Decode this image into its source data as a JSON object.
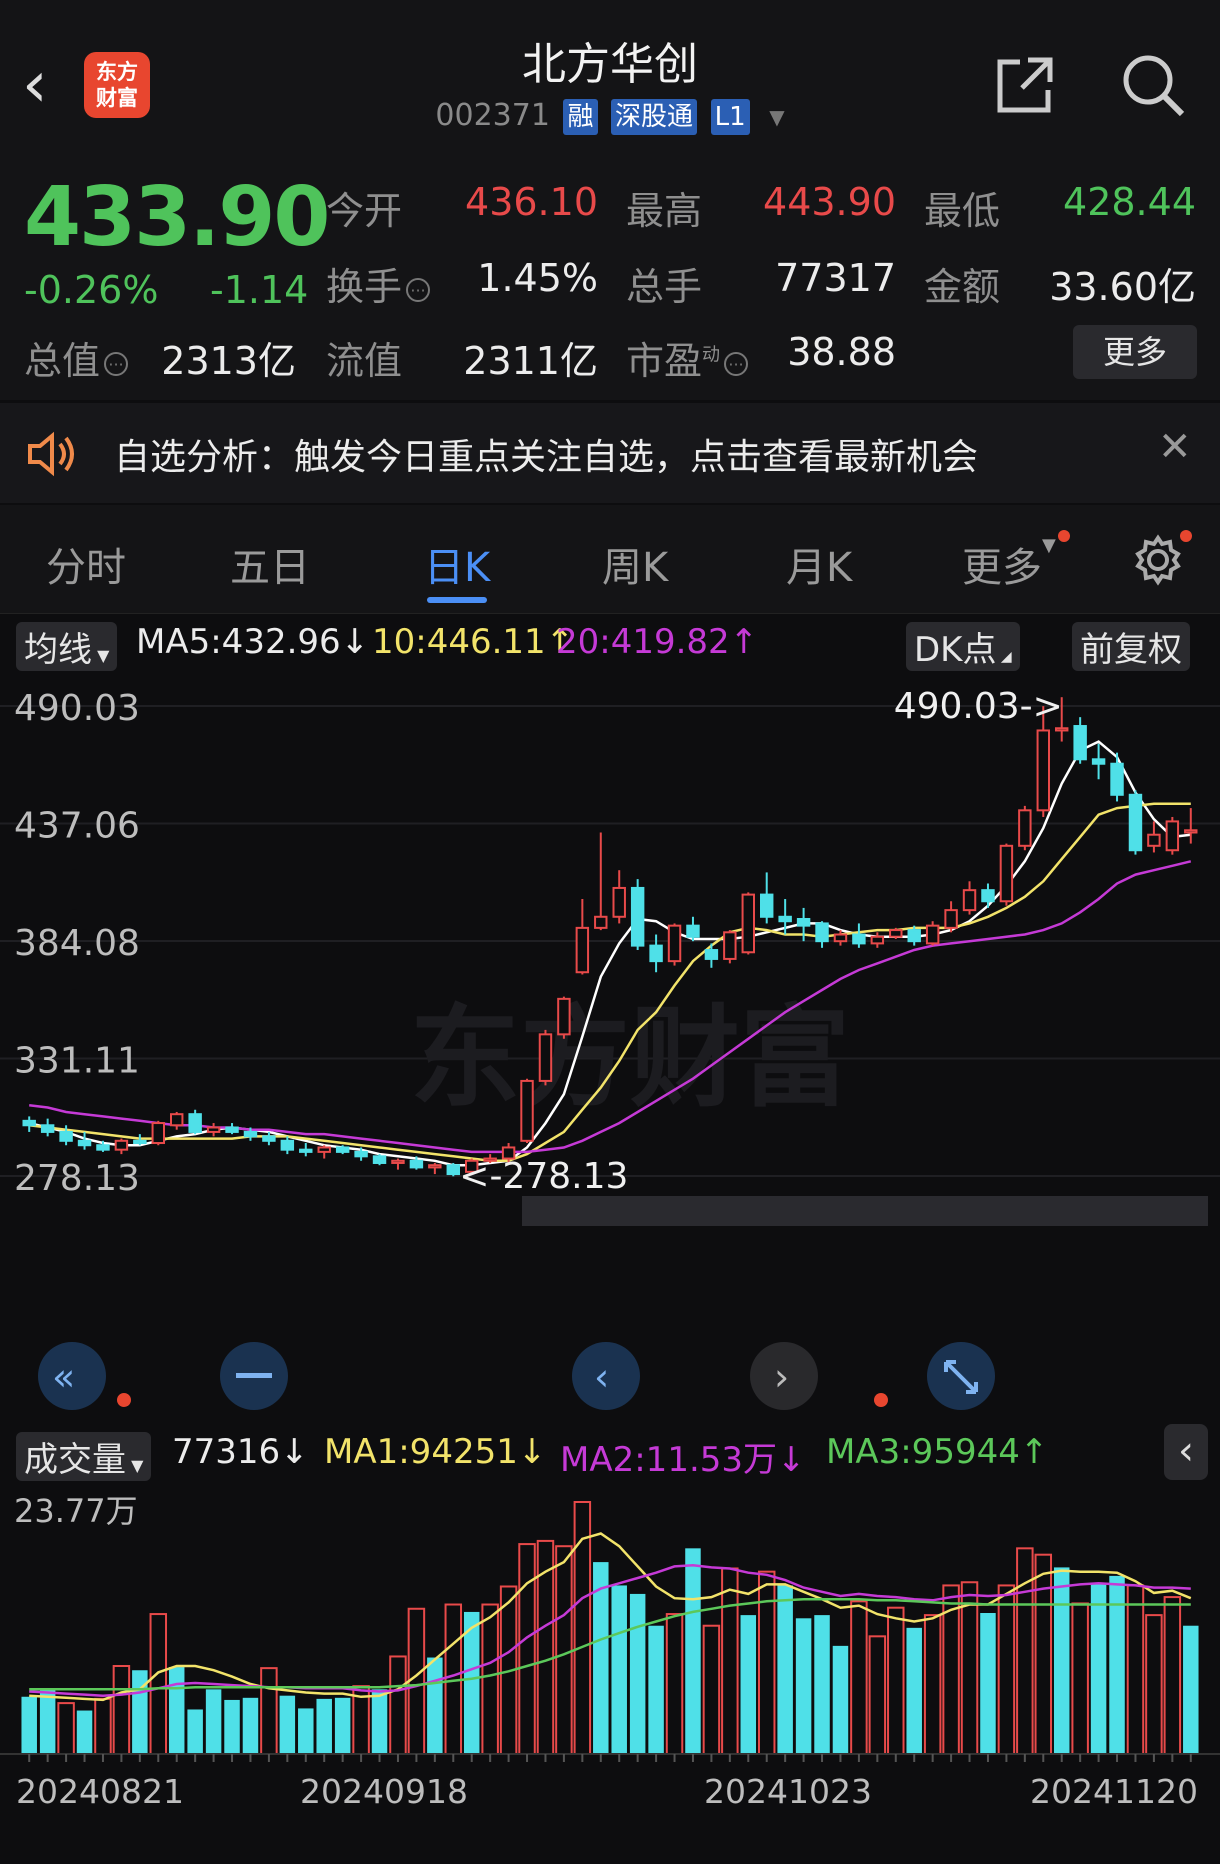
{
  "header": {
    "logo_text": "东方财富",
    "title": "北方华创",
    "code": "002371",
    "tags": [
      "融",
      "深股通",
      "L1"
    ]
  },
  "quote": {
    "price": "433.90",
    "change_pct": "-0.26%",
    "change": "-1.14",
    "open_label": "今开",
    "open": "436.10",
    "high_label": "最高",
    "high": "443.90",
    "low_label": "最低",
    "low": "428.44",
    "turnover_label": "换手",
    "turnover": "1.45%",
    "volume_label": "总手",
    "volume": "77317",
    "amount_label": "金额",
    "amount": "33.60亿",
    "mktcap_label": "总值",
    "mktcap": "2313亿",
    "float_label": "流值",
    "float": "2311亿",
    "pe_label": "市盈",
    "pe_sup": "动",
    "pe": "38.88",
    "more_label": "更多"
  },
  "notice": {
    "text": "自选分析：触发今日重点关注自选，点击查看最新机会"
  },
  "tabs": [
    "分时",
    "五日",
    "日K",
    "周K",
    "月K",
    "更多"
  ],
  "ma_legend": {
    "selector": "均线",
    "ma5": "MA5:432.96↓",
    "ma10": "10:446.11↑",
    "ma20": "20:419.82↑",
    "dk": "DK点",
    "adjust": "前复权"
  },
  "vol_legend": {
    "selector": "成交量",
    "vol": "77316↓",
    "ma1": "MA1:94251↓",
    "ma2": "MA2:11.53万↓",
    "ma3": "MA3:95944↑"
  },
  "colors": {
    "up": "#e84a4a",
    "down": "#4fe0e8",
    "ma5": "#ffffff",
    "ma10": "#f2e36a",
    "ma20": "#c53ad6",
    "vol_ma3": "#5cc85a"
  },
  "chart_data": {
    "type": "candlestick",
    "watermark": "东方财富",
    "price_axis": {
      "ticks": [
        "490.03",
        "437.06",
        "384.08",
        "331.11",
        "278.13"
      ],
      "ylim": [
        278.13,
        490.03
      ]
    },
    "annotations": {
      "max_label": "490.03->",
      "min_label": "<-278.13"
    },
    "candles": [
      [
        303,
        305,
        298,
        301
      ],
      [
        301,
        304,
        296,
        298
      ],
      [
        298,
        301,
        292,
        294
      ],
      [
        294,
        298,
        290,
        292
      ],
      [
        292,
        294,
        289,
        290
      ],
      [
        290,
        295,
        288,
        294
      ],
      [
        294,
        297,
        292,
        293
      ],
      [
        293,
        303,
        292,
        302
      ],
      [
        301,
        307,
        299,
        306
      ],
      [
        306,
        308,
        297,
        298
      ],
      [
        298,
        302,
        296,
        300
      ],
      [
        300,
        302,
        297,
        298
      ],
      [
        298,
        300,
        294,
        296
      ],
      [
        296,
        298,
        292,
        294
      ],
      [
        294,
        296,
        288,
        290
      ],
      [
        290,
        293,
        287,
        289
      ],
      [
        289,
        292,
        286,
        291
      ],
      [
        291,
        292,
        288,
        289
      ],
      [
        289,
        291,
        285,
        287
      ],
      [
        287,
        288,
        283,
        284
      ],
      [
        284,
        286,
        281,
        285
      ],
      [
        285,
        287,
        281,
        282
      ],
      [
        282,
        284,
        279,
        283
      ],
      [
        283,
        284,
        278,
        279
      ],
      [
        280,
        286,
        279,
        285
      ],
      [
        285,
        288,
        284,
        286
      ],
      [
        286,
        293,
        284,
        291
      ],
      [
        294,
        322,
        293,
        321
      ],
      [
        321,
        344,
        319,
        342
      ],
      [
        342,
        359,
        340,
        358
      ],
      [
        370,
        403,
        369,
        390
      ],
      [
        390,
        433,
        389,
        395
      ],
      [
        395,
        416,
        392,
        408
      ],
      [
        408,
        412,
        380,
        382
      ],
      [
        382,
        387,
        370,
        375
      ],
      [
        375,
        392,
        373,
        391
      ],
      [
        391,
        395,
        384,
        386
      ],
      [
        380,
        383,
        372,
        376
      ],
      [
        376,
        389,
        374,
        388
      ],
      [
        379,
        406,
        378,
        405
      ],
      [
        405,
        415,
        392,
        395
      ],
      [
        395,
        403,
        387,
        393
      ],
      [
        394,
        399,
        384,
        391
      ],
      [
        392,
        393,
        381,
        384
      ],
      [
        384,
        389,
        382,
        387
      ],
      [
        387,
        392,
        381,
        383
      ],
      [
        383,
        388,
        381,
        386
      ],
      [
        386,
        390,
        385,
        389
      ],
      [
        389,
        391,
        382,
        384
      ],
      [
        383,
        393,
        382,
        391
      ],
      [
        390,
        402,
        388,
        398
      ],
      [
        398,
        411,
        396,
        407
      ],
      [
        407,
        410,
        399,
        402
      ],
      [
        402,
        428,
        400,
        427
      ],
      [
        427,
        445,
        425,
        443
      ],
      [
        443,
        490,
        440,
        479
      ],
      [
        479,
        494,
        474,
        480
      ],
      [
        481,
        485,
        464,
        466
      ],
      [
        466,
        473,
        457,
        464
      ],
      [
        464,
        469,
        447,
        450
      ],
      [
        450,
        452,
        423,
        425
      ],
      [
        427,
        438,
        424,
        432
      ],
      [
        425,
        440,
        423,
        438
      ],
      [
        433,
        444,
        428,
        434
      ]
    ],
    "ma_lines": [
      {
        "name": "MA5",
        "values": [
          302,
          300,
          298,
          295,
          293,
          292,
          292,
          294,
          296,
          297,
          299,
          300,
          299,
          298,
          296,
          294,
          292,
          291,
          290,
          288,
          287,
          286,
          285,
          283,
          283,
          284,
          285,
          291,
          302,
          315,
          341,
          368,
          383,
          394,
          393,
          388,
          385,
          385,
          385,
          386,
          388,
          390,
          392,
          392,
          389,
          387,
          386,
          386,
          386,
          387,
          389,
          393,
          400,
          409,
          420,
          435,
          455,
          470,
          474,
          467,
          451,
          439,
          431,
          432
        ]
      },
      {
        "name": "MA10",
        "values": [
          301,
          300,
          299,
          298,
          297,
          296,
          295,
          295,
          295,
          295,
          295,
          295,
          296,
          296,
          296,
          295,
          294,
          293,
          292,
          291,
          290,
          289,
          288,
          287,
          286,
          285,
          285,
          288,
          293,
          298,
          308,
          318,
          330,
          344,
          352,
          364,
          375,
          382,
          388,
          390,
          389,
          387,
          387,
          386,
          387,
          388,
          389,
          389,
          390,
          390,
          390,
          392,
          395,
          399,
          404,
          411,
          421,
          431,
          441,
          444,
          445,
          446,
          446,
          446
        ]
      },
      {
        "name": "MA20",
        "values": [
          310,
          309,
          307,
          306,
          305,
          304,
          303,
          302,
          301,
          301,
          300,
          300,
          299,
          299,
          298,
          297,
          297,
          296,
          295,
          294,
          293,
          292,
          291,
          290,
          289,
          289,
          289,
          289,
          290,
          291,
          294,
          298,
          302,
          307,
          312,
          317,
          322,
          328,
          334,
          340,
          346,
          352,
          357,
          362,
          367,
          371,
          374,
          377,
          380,
          382,
          383,
          384,
          385,
          386,
          387,
          389,
          392,
          397,
          403,
          410,
          414,
          416,
          418,
          420
        ]
      }
    ],
    "volume_axis": {
      "max_label": "23.77万"
    },
    "volume": [
      {
        "v": 5.4,
        "up": false
      },
      {
        "v": 6.1,
        "up": false
      },
      {
        "v": 4.8,
        "up": true
      },
      {
        "v": 4.1,
        "up": false
      },
      {
        "v": 5.2,
        "up": true
      },
      {
        "v": 8.3,
        "up": true
      },
      {
        "v": 7.9,
        "up": false
      },
      {
        "v": 13.2,
        "up": true
      },
      {
        "v": 8.2,
        "up": false
      },
      {
        "v": 4.2,
        "up": false
      },
      {
        "v": 6.1,
        "up": false
      },
      {
        "v": 5.1,
        "up": false
      },
      {
        "v": 5.3,
        "up": false
      },
      {
        "v": 8.1,
        "up": true
      },
      {
        "v": 5.5,
        "up": false
      },
      {
        "v": 4.3,
        "up": false
      },
      {
        "v": 5.2,
        "up": false
      },
      {
        "v": 5.3,
        "up": false
      },
      {
        "v": 6.4,
        "up": true
      },
      {
        "v": 6.1,
        "up": false
      },
      {
        "v": 9.2,
        "up": true
      },
      {
        "v": 13.7,
        "up": true
      },
      {
        "v": 9.1,
        "up": false
      },
      {
        "v": 14.1,
        "up": true
      },
      {
        "v": 13.4,
        "up": false
      },
      {
        "v": 14.1,
        "up": true
      },
      {
        "v": 15.8,
        "up": true
      },
      {
        "v": 19.8,
        "up": true
      },
      {
        "v": 20.1,
        "up": true
      },
      {
        "v": 19.6,
        "up": true
      },
      {
        "v": 23.77,
        "up": true
      },
      {
        "v": 18.1,
        "up": false
      },
      {
        "v": 15.9,
        "up": false
      },
      {
        "v": 15.1,
        "up": false
      },
      {
        "v": 12.1,
        "up": false
      },
      {
        "v": 13.2,
        "up": true
      },
      {
        "v": 19.4,
        "up": false
      },
      {
        "v": 12.1,
        "up": true
      },
      {
        "v": 17.5,
        "up": true
      },
      {
        "v": 13.1,
        "up": false
      },
      {
        "v": 17.2,
        "up": true
      },
      {
        "v": 15.9,
        "up": false
      },
      {
        "v": 12.8,
        "up": false
      },
      {
        "v": 13.1,
        "up": false
      },
      {
        "v": 10.2,
        "up": false
      },
      {
        "v": 14.4,
        "up": true
      },
      {
        "v": 11.1,
        "up": true
      },
      {
        "v": 13.8,
        "up": true
      },
      {
        "v": 11.9,
        "up": false
      },
      {
        "v": 13.1,
        "up": true
      },
      {
        "v": 15.9,
        "up": true
      },
      {
        "v": 16.2,
        "up": true
      },
      {
        "v": 13.3,
        "up": false
      },
      {
        "v": 15.9,
        "up": true
      },
      {
        "v": 19.4,
        "up": true
      },
      {
        "v": 18.8,
        "up": true
      },
      {
        "v": 17.6,
        "up": false
      },
      {
        "v": 14.2,
        "up": true
      },
      {
        "v": 16.1,
        "up": false
      },
      {
        "v": 16.8,
        "up": false
      },
      {
        "v": 15.9,
        "up": true
      },
      {
        "v": 13.1,
        "up": true
      },
      {
        "v": 14.8,
        "up": true
      },
      {
        "v": 12.1,
        "up": false
      }
    ],
    "volume_ma": [
      {
        "name": "MA1",
        "values": [
          5.5,
          5.4,
          5.3,
          5.2,
          5.1,
          5.8,
          6.1,
          7.7,
          8.3,
          8.3,
          7.9,
          7.3,
          6.6,
          6.2,
          6.0,
          5.8,
          5.7,
          5.7,
          5.4,
          5.5,
          6.1,
          7.4,
          8.9,
          10.4,
          11.9,
          12.9,
          14.3,
          16.1,
          17.2,
          18.1,
          20.3,
          20.8,
          19.6,
          17.7,
          15.8,
          14.7,
          14.6,
          14.8,
          15.5,
          15.1,
          16.0,
          16.0,
          15.3,
          14.6,
          13.8,
          14.0,
          13.2,
          12.8,
          12.5,
          12.8,
          13.6,
          14.1,
          14.1,
          15.1,
          16.1,
          17.0,
          17.3,
          17.2,
          17.2,
          17.1,
          16.3,
          15.2,
          15.4,
          14.7
        ]
      },
      {
        "name": "MA2",
        "values": [
          5.9,
          5.8,
          5.7,
          5.6,
          5.5,
          5.6,
          5.8,
          6.2,
          6.6,
          6.7,
          6.6,
          6.5,
          6.4,
          6.3,
          6.3,
          6.2,
          6.2,
          6.2,
          6.0,
          5.9,
          6.0,
          6.4,
          6.9,
          7.4,
          8.0,
          8.6,
          9.6,
          11.0,
          12.1,
          13.1,
          14.7,
          15.6,
          16.1,
          16.6,
          17.1,
          17.7,
          17.8,
          17.6,
          17.5,
          17.1,
          16.9,
          16.4,
          15.7,
          15.3,
          14.9,
          15.1,
          14.9,
          14.8,
          14.6,
          14.5,
          14.8,
          15.0,
          14.9,
          15.0,
          15.3,
          15.6,
          15.8,
          16.0,
          16.1,
          16.0,
          15.9,
          15.7,
          15.7,
          15.6
        ]
      },
      {
        "name": "MA3",
        "values": [
          6.1,
          6.1,
          6.1,
          6.1,
          6.1,
          6.1,
          6.1,
          6.2,
          6.2,
          6.3,
          6.3,
          6.3,
          6.3,
          6.3,
          6.3,
          6.3,
          6.3,
          6.3,
          6.3,
          6.3,
          6.4,
          6.5,
          6.7,
          6.9,
          7.1,
          7.4,
          7.8,
          8.3,
          8.8,
          9.4,
          10.1,
          10.8,
          11.4,
          12.0,
          12.5,
          13.0,
          13.4,
          13.7,
          14.0,
          14.2,
          14.4,
          14.5,
          14.6,
          14.6,
          14.6,
          14.6,
          14.5,
          14.5,
          14.4,
          14.3,
          14.2,
          14.2,
          14.1,
          14.1,
          14.1,
          14.1,
          14.1,
          14.1,
          14.1,
          14.1,
          14.1,
          14.1,
          14.1,
          14.1
        ]
      }
    ],
    "x_labels": [
      "20240821",
      "20240918",
      "20241023",
      "20241120"
    ]
  }
}
